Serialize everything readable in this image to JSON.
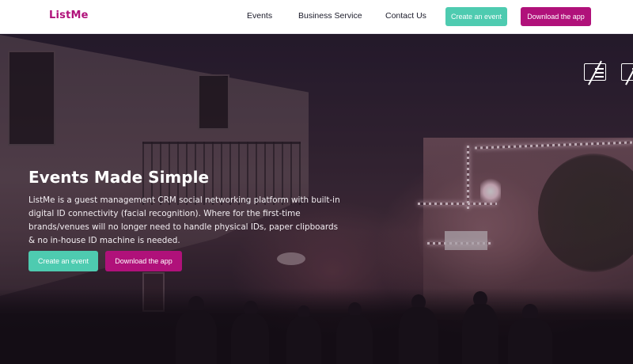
{
  "brand": {
    "logo": "ListMe",
    "primary_color": "#b0117a",
    "accent_color": "#4ecbb0"
  },
  "nav": {
    "links": [
      "Events",
      "Business Service",
      "Contact Us"
    ],
    "create_button": "Create an event",
    "download_button": "Download the app"
  },
  "hero": {
    "title": "Events Made Simple",
    "description": "ListMe is a guest management CRM social networking platform with built-in digital ID connectivity (facial recognition). Where for the first-time brands/venues will no longer need to handle physical IDs, paper clipboards & no in-house ID machine is needed.",
    "create_button": "Create an event",
    "download_button": "Download the app",
    "icons": [
      "no-id-card-icon",
      "no-id-card-icon"
    ]
  }
}
